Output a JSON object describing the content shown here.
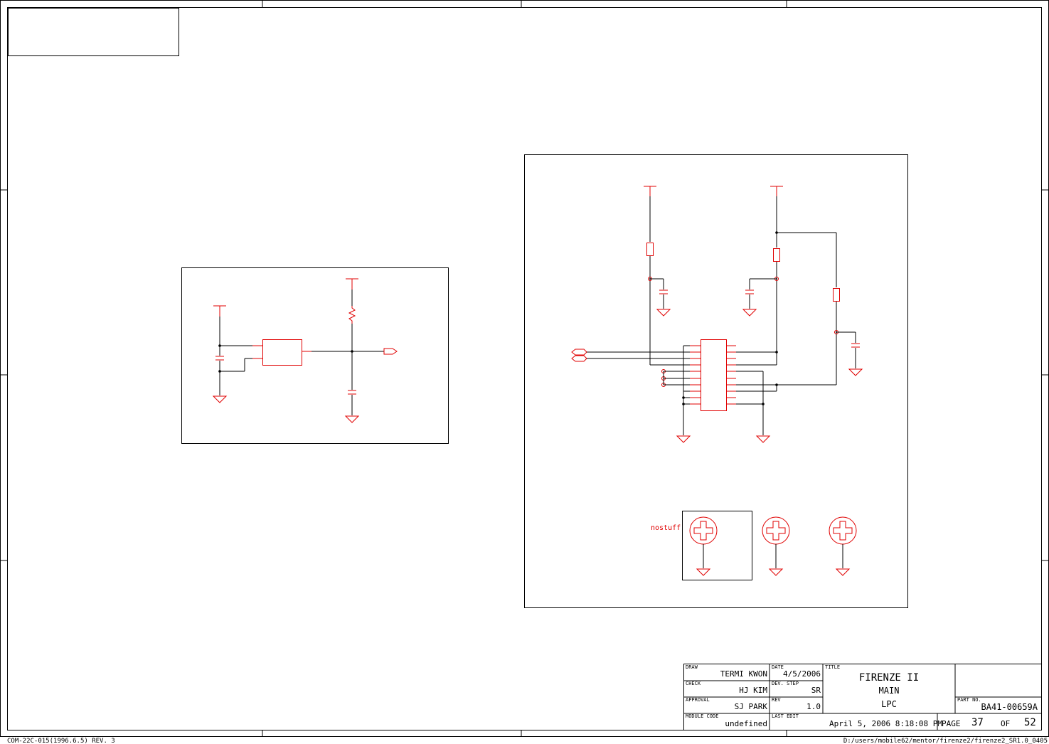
{
  "title_block": {
    "draw_label": "DRAW",
    "draw_value": "TERMI KWON",
    "check_label": "CHECK",
    "check_value": "HJ KIM",
    "approval_label": "APPROVAL",
    "approval_value": "SJ PARK",
    "module_code_label": "MODULE CODE",
    "module_code_value": "undefined",
    "date_label": "DATE",
    "date_value": "4/5/2006",
    "dev_step_label": "DEV. STEP",
    "dev_step_value": "SR",
    "rev_label": "REV",
    "rev_value": "1.0",
    "last_edit_label": "LAST EDIT",
    "last_edit_value": "April 5, 2006  8:18:08 PM",
    "title_label": "TITLE",
    "title_line1": "FIRENZE II",
    "title_line2": "MAIN",
    "title_line3": "LPC",
    "part_no_label": "PART NO.",
    "part_no_value": "BA41-00659A",
    "page_label": "PAGE",
    "page_value": "37",
    "of_label": "OF",
    "of_value": "52"
  },
  "footer": {
    "left": "COM-22C-015(1996.6.5) REV. 3",
    "right": "D:/users/mobile62/mentor/firenze2/firenze2_SR1.0_0405"
  },
  "schematic": {
    "nostuff_label": "nostuff"
  },
  "colors": {
    "component": "#e00000",
    "wire": "#000000"
  }
}
